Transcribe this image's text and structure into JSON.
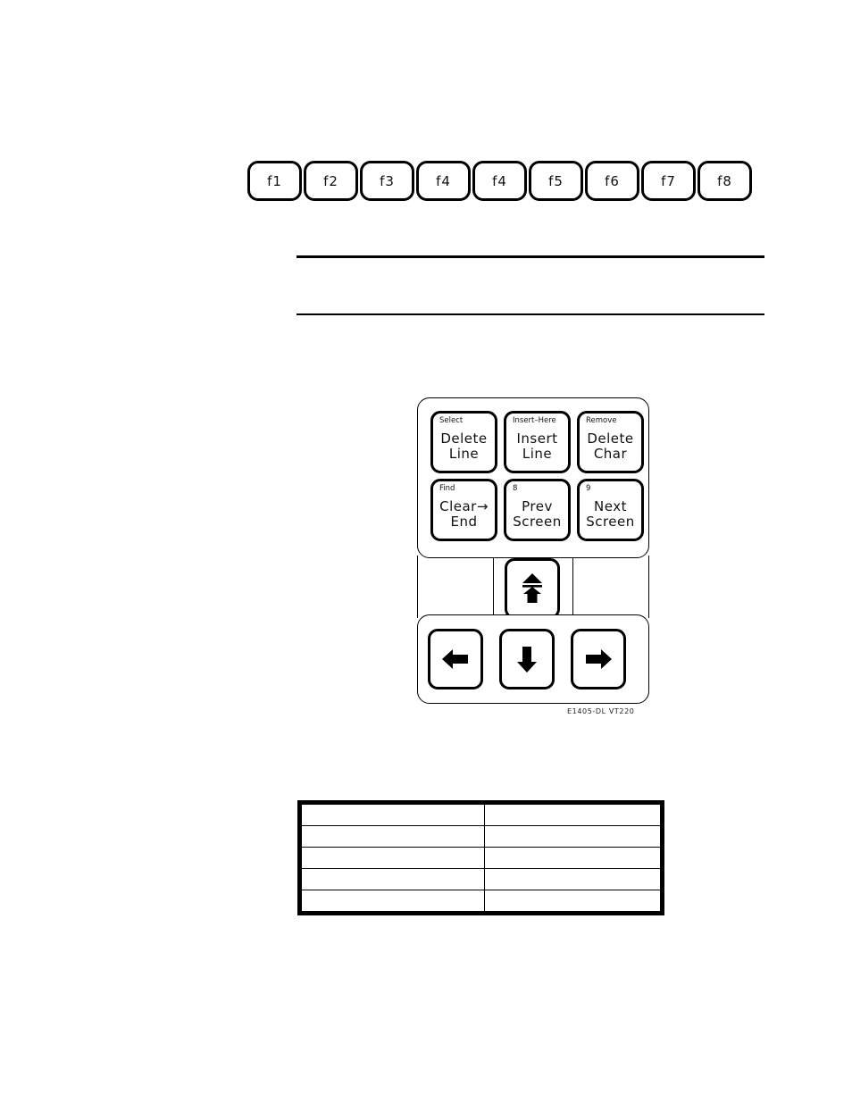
{
  "document": {
    "figure_caption": "E1405-DL VT220"
  },
  "function_keys": [
    {
      "label": "f1",
      "name": "fkey-f1"
    },
    {
      "label": "f2",
      "name": "fkey-f2"
    },
    {
      "label": "f3",
      "name": "fkey-f3"
    },
    {
      "label": "f4",
      "name": "fkey-f4"
    },
    {
      "label": "f4",
      "name": "fkey-f4-duplicate"
    },
    {
      "label": "f5",
      "name": "fkey-f5"
    },
    {
      "label": "f6",
      "name": "fkey-f6"
    },
    {
      "label": "f7",
      "name": "fkey-f7"
    },
    {
      "label": "f8",
      "name": "fkey-f8"
    }
  ],
  "editing_keypad": {
    "keys": [
      {
        "legend": "Select",
        "line1": "Delete",
        "line2": "Line"
      },
      {
        "legend": "Insert–Here",
        "line1": "Insert",
        "line2": "Line"
      },
      {
        "legend": "Remove",
        "line1": "Delete",
        "line2": "Char"
      },
      {
        "legend": "Find",
        "line1": "Clear→",
        "line2": "End"
      },
      {
        "legend": "8",
        "line1": "Prev",
        "line2": "Screen"
      },
      {
        "legend": "9",
        "line1": "Next",
        "line2": "Screen"
      }
    ]
  },
  "arrow_keys": {
    "up": "up-arrow",
    "left": "left-arrow",
    "down": "down-arrow",
    "right": "right-arrow"
  },
  "blank_table": {
    "rows": 5,
    "columns": 2
  }
}
